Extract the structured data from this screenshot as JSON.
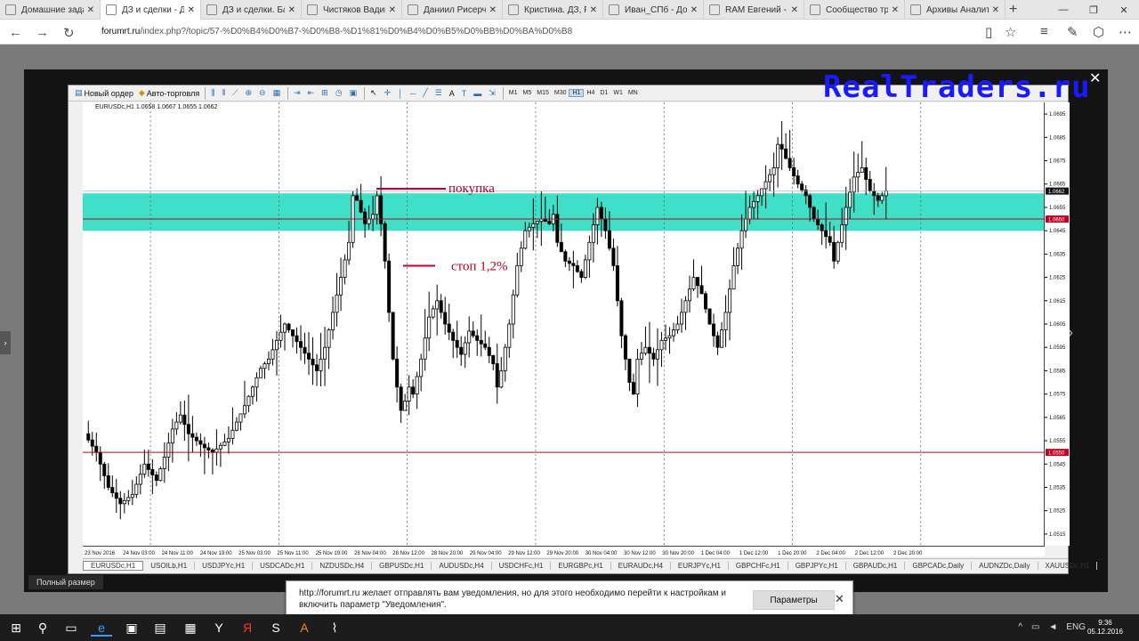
{
  "browser": {
    "tabs": [
      {
        "label": "Домашние задания и",
        "active": false
      },
      {
        "label": "ДЗ и сделки - Дом",
        "active": true
      },
      {
        "label": "ДЗ и сделки. Баходир",
        "active": false
      },
      {
        "label": "Чистяков Вадим ДЗ -",
        "active": false
      },
      {
        "label": "Даниил Рисерч - Дом",
        "active": false
      },
      {
        "label": "Кристина. ДЗ, Рисерч",
        "active": false
      },
      {
        "label": "Иван_СПб - Домашни",
        "active": false
      },
      {
        "label": "RAM Евгений - Домаш",
        "active": false
      },
      {
        "label": "Сообщество трейдер",
        "active": false
      },
      {
        "label": "Архивы Аналитика - F",
        "active": false
      }
    ],
    "url_domain": "forumrt.ru",
    "url_path": "/index.php?/topic/57-%D0%B4%D0%B7-%D0%B8-%D1%81%D0%B4%D0%B5%D0%BB%D0%BA%D0%B8"
  },
  "overlay": {
    "logo": "RealTraders.ru",
    "fullsize_label": "Полный размер"
  },
  "mt4": {
    "toolbar": {
      "new_order": "Новый ордер",
      "autotrade": "Авто-торговля",
      "timeframes": [
        "M1",
        "M5",
        "M15",
        "M30",
        "H1",
        "H4",
        "D1",
        "W1",
        "MN"
      ],
      "active_tf": "H1"
    },
    "header": "EURUSDc,H1  1.0658 1.0667 1.0655 1.0662",
    "symbol_tabs": [
      "EURUSDc,H1",
      "USOILb,H1",
      "USDJPYc,H1",
      "USDCADc,H1",
      "NZDUSDc,H4",
      "GBPUSDc,H1",
      "AUDUSDc,H4",
      "USDCHFc,H1",
      "EURGBPc,H1",
      "EURAUDc,H4",
      "EURJPYc,H1",
      "GBPCHFc,H1",
      "GBPJPYc,H1",
      "GBPAUDc,H1",
      "GBPCADc,Daily",
      "AUDNZDc,Daily",
      "XAUUSDc,H1"
    ],
    "active_symbol_tab": "EURUSDc,H1"
  },
  "chart_data": {
    "type": "candlestick",
    "symbol": "EURUSDc",
    "timeframe": "H1",
    "ylim": [
      1.051,
      1.07
    ],
    "y_ticks": [
      "1.0695",
      "1.0685",
      "1.0675",
      "1.0665",
      "1.0655",
      "1.0645",
      "1.0635",
      "1.0625",
      "1.0615",
      "1.0605",
      "1.0595",
      "1.0585",
      "1.0575",
      "1.0565",
      "1.0555",
      "1.0545",
      "1.0535",
      "1.0525",
      "1.0515"
    ],
    "x_ticks": [
      "23 Nov 2016",
      "24 Nov 03:00",
      "24 Nov 11:00",
      "24 Nov 19:00",
      "25 Nov 03:00",
      "25 Nov 11:00",
      "25 Nov 19:00",
      "28 Nov 04:00",
      "28 Nov 12:00",
      "28 Nov 20:00",
      "29 Nov 04:00",
      "29 Nov 12:00",
      "29 Nov 20:00",
      "30 Nov 04:00",
      "30 Nov 12:00",
      "30 Nov 20:00",
      "1 Dec 04:00",
      "1 Dec 12:00",
      "1 Dec 20:00",
      "2 Dec 04:00",
      "2 Dec 12:00",
      "2 Dec 20:00"
    ],
    "current_price": "1.0662",
    "price_labels": [
      {
        "value": 1.065,
        "label": "1.0650",
        "color": "#c00020"
      },
      {
        "value": 1.055,
        "label": "1.0550",
        "color": "#c00020"
      }
    ],
    "zone": {
      "low": 1.0645,
      "high": 1.0661,
      "color": "#40e0c8"
    },
    "annotations": [
      {
        "text": "покупка",
        "price": 1.0663
      },
      {
        "text": "стоп 1,2%",
        "price": 1.063
      }
    ],
    "path_points": [
      [
        0,
        1.0558
      ],
      [
        3,
        1.055
      ],
      [
        6,
        1.0535
      ],
      [
        9,
        1.0528
      ],
      [
        12,
        1.0532
      ],
      [
        15,
        1.0545
      ],
      [
        18,
        1.0538
      ],
      [
        20,
        1.0548
      ],
      [
        22,
        1.056
      ],
      [
        24,
        1.0566
      ],
      [
        26,
        1.0558
      ],
      [
        28,
        1.0555
      ],
      [
        30,
        1.0552
      ],
      [
        32,
        1.055
      ],
      [
        34,
        1.0553
      ],
      [
        36,
        1.0556
      ],
      [
        38,
        1.0563
      ],
      [
        40,
        1.057
      ],
      [
        42,
        1.0578
      ],
      [
        44,
        1.0586
      ],
      [
        46,
        1.059
      ],
      [
        48,
        1.0598
      ],
      [
        50,
        1.0605
      ],
      [
        52,
        1.06
      ],
      [
        54,
        1.0595
      ],
      [
        56,
        1.059
      ],
      [
        58,
        1.0585
      ],
      [
        60,
        1.0595
      ],
      [
        62,
        1.061
      ],
      [
        64,
        1.0625
      ],
      [
        66,
        1.064
      ],
      [
        67,
        1.066
      ],
      [
        68,
        1.0658
      ],
      [
        70,
        1.0648
      ],
      [
        72,
        1.0652
      ],
      [
        73,
        1.066
      ],
      [
        74,
        1.0648
      ],
      [
        75,
        1.0632
      ],
      [
        76,
        1.061
      ],
      [
        77,
        1.059
      ],
      [
        78,
        1.0578
      ],
      [
        79,
        1.0568
      ],
      [
        80,
        1.0572
      ],
      [
        81,
        1.0578
      ],
      [
        82,
        1.0575
      ],
      [
        84,
        1.059
      ],
      [
        86,
        1.0608
      ],
      [
        88,
        1.0615
      ],
      [
        90,
        1.0605
      ],
      [
        92,
        1.0598
      ],
      [
        94,
        1.0592
      ],
      [
        96,
        1.0602
      ],
      [
        98,
        1.0598
      ],
      [
        100,
        1.0595
      ],
      [
        102,
        1.0588
      ],
      [
        103,
        1.0578
      ],
      [
        104,
        1.0585
      ],
      [
        106,
        1.0605
      ],
      [
        108,
        1.063
      ],
      [
        110,
        1.0645
      ],
      [
        112,
        1.0648
      ],
      [
        114,
        1.065
      ],
      [
        116,
        1.0648
      ],
      [
        117,
        1.0652
      ],
      [
        118,
        1.064
      ],
      [
        120,
        1.0632
      ],
      [
        122,
        1.063
      ],
      [
        124,
        1.0625
      ],
      [
        126,
        1.064
      ],
      [
        128,
        1.0655
      ],
      [
        130,
        1.0645
      ],
      [
        132,
        1.063
      ],
      [
        133,
        1.0615
      ],
      [
        134,
        1.06
      ],
      [
        136,
        1.058
      ],
      [
        137,
        1.0575
      ],
      [
        138,
        1.059
      ],
      [
        140,
        1.0595
      ],
      [
        142,
        1.059
      ],
      [
        144,
        1.0598
      ],
      [
        146,
        1.06
      ],
      [
        148,
        1.0605
      ],
      [
        150,
        1.0615
      ],
      [
        152,
        1.0625
      ],
      [
        154,
        1.0618
      ],
      [
        156,
        1.0605
      ],
      [
        158,
        1.0595
      ],
      [
        160,
        1.061
      ],
      [
        162,
        1.063
      ],
      [
        164,
        1.0645
      ],
      [
        166,
        1.0655
      ],
      [
        168,
        1.066
      ],
      [
        170,
        1.0666
      ],
      [
        172,
        1.0672
      ],
      [
        173,
        1.0682
      ],
      [
        174,
        1.068
      ],
      [
        176,
        1.0672
      ],
      [
        178,
        1.0665
      ],
      [
        180,
        1.066
      ],
      [
        182,
        1.065
      ],
      [
        184,
        1.0645
      ],
      [
        186,
        1.064
      ],
      [
        187,
        1.0632
      ],
      [
        188,
        1.064
      ],
      [
        190,
        1.0655
      ],
      [
        192,
        1.0668
      ],
      [
        194,
        1.0672
      ],
      [
        196,
        1.0662
      ],
      [
        198,
        1.0658
      ],
      [
        200,
        1.0662
      ]
    ]
  },
  "notification": {
    "text": "http://forumrt.ru желает отправлять вам уведомления, но для этого необходимо перейти к настройкам и включить параметр \"Уведомления\".",
    "button": "Параметры"
  },
  "taskbar": {
    "lang": "ENG",
    "time": "9:36",
    "date": "05.12.2016"
  }
}
